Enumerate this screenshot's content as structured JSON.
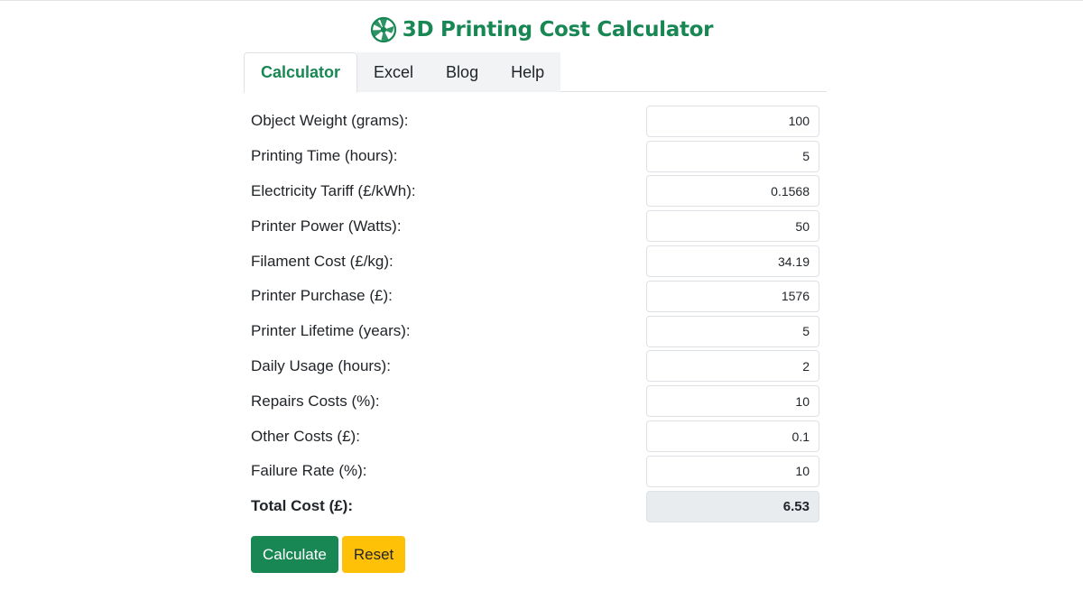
{
  "header": {
    "title": "3D Printing Cost Calculator",
    "icon": "green-wheel-icon"
  },
  "tabs": [
    {
      "label": "Calculator",
      "active": true
    },
    {
      "label": "Excel",
      "active": false
    },
    {
      "label": "Blog",
      "active": false
    },
    {
      "label": "Help",
      "active": false
    }
  ],
  "fields": [
    {
      "label": "Object Weight (grams):",
      "value": "100"
    },
    {
      "label": "Printing Time (hours):",
      "value": "5"
    },
    {
      "label": "Electricity Tariff (£/kWh):",
      "value": "0.1568"
    },
    {
      "label": "Printer Power (Watts):",
      "value": "50"
    },
    {
      "label": "Filament Cost (£/kg):",
      "value": "34.19"
    },
    {
      "label": "Printer Purchase (£):",
      "value": "1576"
    },
    {
      "label": "Printer Lifetime (years):",
      "value": "5"
    },
    {
      "label": "Daily Usage (hours):",
      "value": "2"
    },
    {
      "label": "Repairs Costs (%):",
      "value": "10"
    },
    {
      "label": "Other Costs (£):",
      "value": "0.1"
    },
    {
      "label": "Failure Rate (%):",
      "value": "10"
    }
  ],
  "total": {
    "label": "Total Cost (£):",
    "value": "6.53"
  },
  "buttons": {
    "calculate": "Calculate",
    "reset": "Reset"
  },
  "colors": {
    "accent": "#198754",
    "warning": "#ffc107",
    "readonly_bg": "#e9ecef"
  }
}
